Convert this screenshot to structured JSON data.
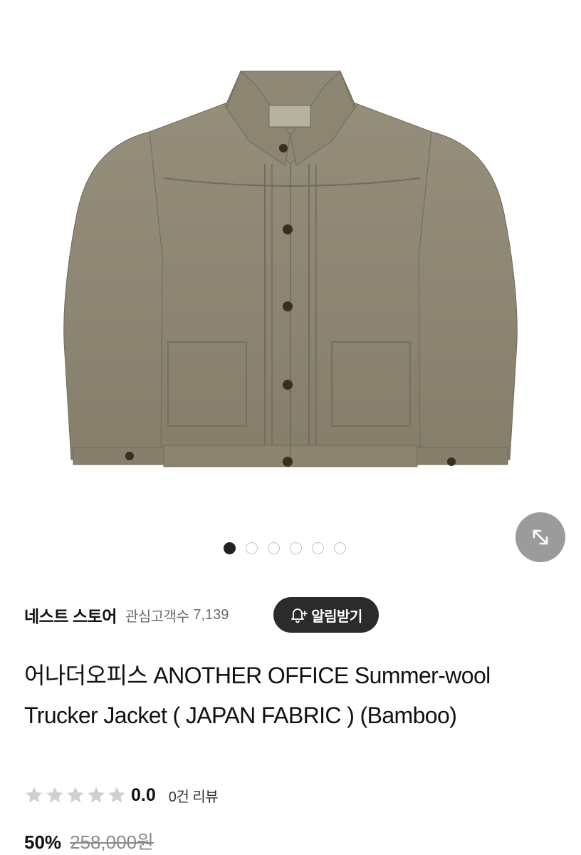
{
  "product_images": {
    "count": 6,
    "active_index": 0
  },
  "store": {
    "name": "네스트 스토어",
    "follower_label": "관심고객수",
    "follower_count": "7,139"
  },
  "notify_button": {
    "label": "알림받기",
    "icon": "bell-plus-icon"
  },
  "product": {
    "title": "어나더오피스 ANOTHER OFFICE Summer-wool Trucker Jacket ( JAPAN FABRIC ) (Bamboo)"
  },
  "rating": {
    "stars": 0,
    "max_stars": 5,
    "value": "0.0",
    "review_count_label": "0건 리뷰"
  },
  "price": {
    "discount": "50%",
    "original": "258,000원"
  },
  "colors": {
    "jacket": "#8e8774",
    "dark_button": "#2b2b2b",
    "expand_button": "#9b9b9b",
    "star_inactive": "#d0d0d0"
  },
  "icons": {
    "expand": "expand-arrows-icon",
    "star": "star-icon"
  }
}
